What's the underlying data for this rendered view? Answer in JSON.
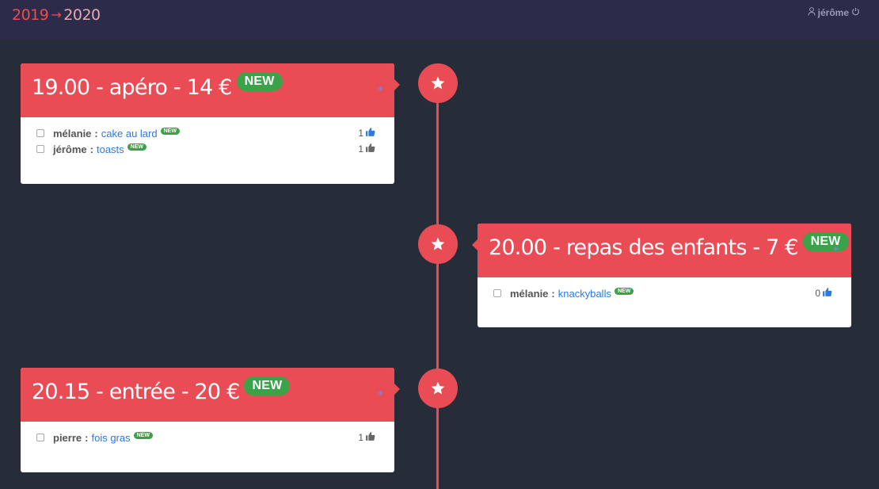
{
  "header": {
    "brand_from": "2019",
    "brand_arrow": "→",
    "brand_to": "2020",
    "user": "jérôme"
  },
  "colors": {
    "accent": "#ea4c55",
    "background": "#262d38",
    "topbar": "#2c2c4a",
    "new_badge": "#3aa34a",
    "link": "#2a7ae2"
  },
  "events": [
    {
      "title": "19.00 - apéro - 14 €",
      "badge": "NEW",
      "items": [
        {
          "who": "mélanie",
          "sep": ":",
          "dish": "cake au lard",
          "badge": "NEW",
          "votes": "1",
          "thumb_color": "#2a7ae2"
        },
        {
          "who": "jérôme",
          "sep": ":",
          "dish": "toasts",
          "badge": "NEW",
          "votes": "1",
          "thumb_color": "#666666"
        }
      ]
    },
    {
      "title": "20.00 - repas des enfants - 7 €",
      "badge": "NEW",
      "items": [
        {
          "who": "mélanie",
          "sep": ":",
          "dish": "knackyballs",
          "badge": "NEW",
          "votes": "0",
          "thumb_color": "#2a7ae2"
        }
      ]
    },
    {
      "title": "20.15 - entrée - 20 €",
      "badge": "NEW",
      "items": [
        {
          "who": "pierre",
          "sep": ":",
          "dish": "fois gras",
          "badge": "NEW",
          "votes": "1",
          "thumb_color": "#666666"
        }
      ]
    }
  ]
}
